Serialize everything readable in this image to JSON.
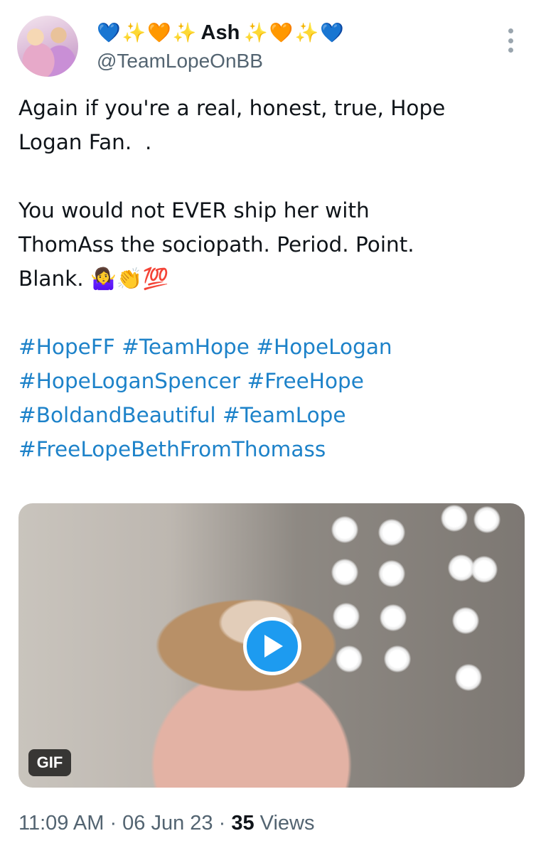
{
  "author": {
    "emoji_prefix": [
      "💙",
      "✨",
      "🧡",
      "✨"
    ],
    "display_name": "Ash",
    "emoji_suffix": [
      "✨",
      "🧡",
      "✨",
      "💙"
    ],
    "handle": "@TeamLopeOnBB"
  },
  "tweet": {
    "paragraph1": "Again if you're a real, honest, true, Hope\nLogan Fan.  .",
    "paragraph2": "You would not EVER ship her with\nThomAss the sociopath. Period. Point.\nBlank. 🤷‍♀️👏💯",
    "hashtag_lines": [
      "#HopeFF #TeamHope #HopeLogan",
      "#HopeLoganSpencer #FreeHope",
      "#BoldandBeautiful #TeamLope",
      "#FreeLopeBethFromThomass"
    ]
  },
  "media": {
    "badge": "GIF",
    "play_icon": "play-icon"
  },
  "meta": {
    "time": "11:09 AM",
    "separator": " · ",
    "date": "06 Jun 23",
    "views_count": "35",
    "views_label": " Views"
  },
  "colors": {
    "hashtag": "#1d82c9",
    "play_button": "#1d9bf0",
    "secondary_text": "#536471"
  }
}
